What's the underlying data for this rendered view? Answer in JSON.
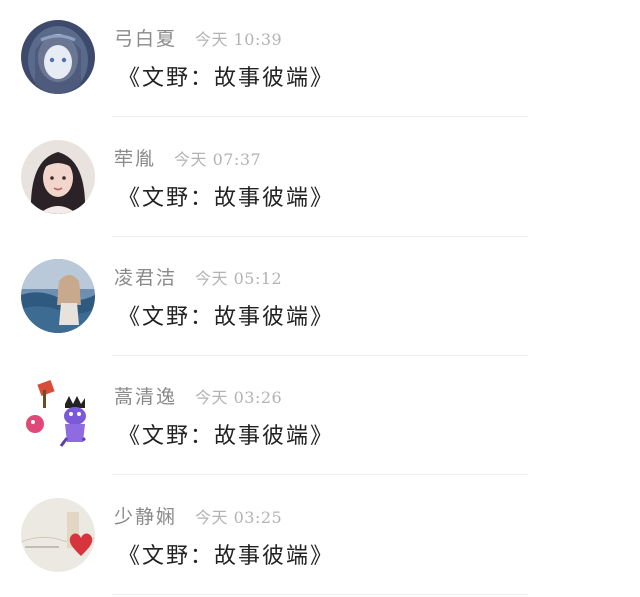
{
  "comments": [
    {
      "name": "弓白夏",
      "time": "今天 10:39",
      "text": "《文野：故事彼端》",
      "avatar_icon": "anime-hooded-avatar"
    },
    {
      "name": "荦胤",
      "time": "今天 07:37",
      "text": "《文野：故事彼端》",
      "avatar_icon": "girl-portrait-avatar"
    },
    {
      "name": "凌君洁",
      "time": "今天 05:12",
      "text": "《文野：故事彼端》",
      "avatar_icon": "ocean-girl-avatar"
    },
    {
      "name": "蒿清逸",
      "time": "今天 03:26",
      "text": "《文野：故事彼端》",
      "avatar_icon": "cartoon-monster-avatar"
    },
    {
      "name": "少静娴",
      "time": "今天 03:25",
      "text": "《文野：故事彼端》",
      "avatar_icon": "paper-heart-avatar"
    }
  ],
  "colors": {
    "name": "#8a8a8a",
    "time": "#b3b3b3",
    "text": "#222222",
    "divider": "#eeeeee"
  }
}
